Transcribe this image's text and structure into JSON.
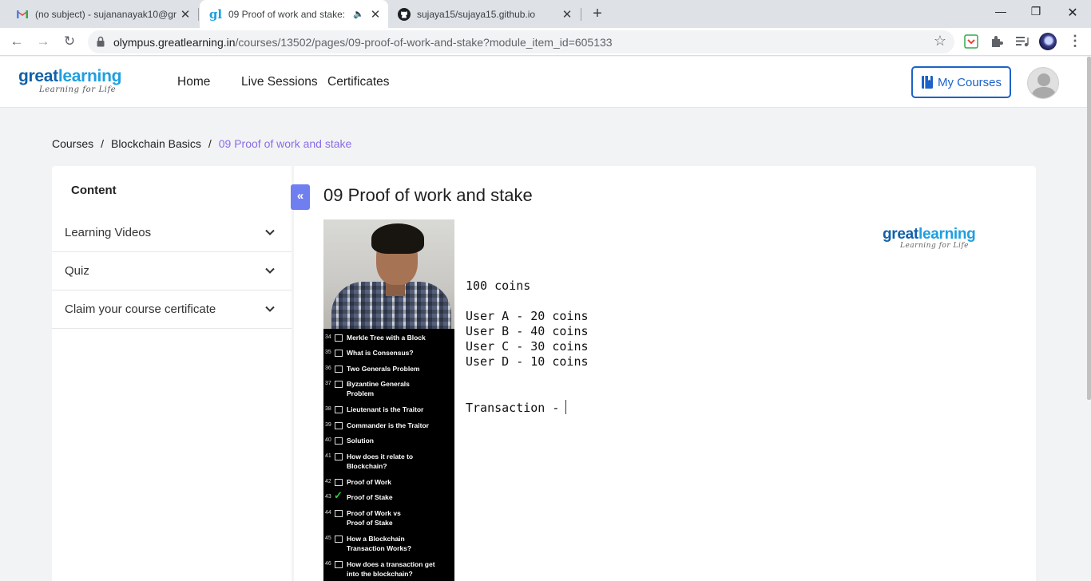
{
  "browser": {
    "tabs": [
      {
        "title": "(no subject) - sujananayak10@gr",
        "icon": "gmail-icon",
        "active": false
      },
      {
        "title": "09 Proof of work and stake: P",
        "icon": "greatlearning-icon",
        "active": true
      },
      {
        "title": "sujaya15/sujaya15.github.io",
        "icon": "github-icon",
        "active": false
      }
    ],
    "url_host": "olympus.greatlearning.in",
    "url_path": "/courses/13502/pages/09-proof-of-work-and-stake?module_item_id=605133"
  },
  "header": {
    "logo_part1": "great",
    "logo_part2": "learning",
    "logo_tagline": "Learning for Life",
    "nav": [
      "Home",
      "Live Sessions",
      "Certificates"
    ],
    "my_courses": "My Courses"
  },
  "breadcrumb": {
    "items": [
      "Courses",
      "Blockchain Basics"
    ],
    "current": "09 Proof of work and stake"
  },
  "sidebar": {
    "heading": "Content",
    "sections": [
      "Learning Videos",
      "Quiz",
      "Claim your course certificate"
    ]
  },
  "main": {
    "title": "09 Proof of work and stake"
  },
  "video": {
    "items": [
      {
        "num": "34",
        "label": "Merkle Tree with a Block",
        "checked": false
      },
      {
        "num": "35",
        "label": "What is Consensus?",
        "checked": false
      },
      {
        "num": "36",
        "label": "Two Generals Problem",
        "checked": false
      },
      {
        "num": "37",
        "label": "Byzantine Generals Problem",
        "checked": false
      },
      {
        "num": "38",
        "label": "Lieutenant is the Traitor",
        "checked": false
      },
      {
        "num": "39",
        "label": "Commander is the Traitor",
        "checked": false
      },
      {
        "num": "40",
        "label": "Solution",
        "checked": false
      },
      {
        "num": "41",
        "label": "How does it relate to Blockchain?",
        "checked": false
      },
      {
        "num": "42",
        "label": "Proof of Work",
        "checked": false
      },
      {
        "num": "43",
        "label": "Proof of Stake",
        "checked": true
      },
      {
        "num": "44",
        "label": "Proof of Work vs Proof of Stake",
        "checked": false
      },
      {
        "num": "45",
        "label": "How a Blockchain Transaction Works?",
        "checked": false
      },
      {
        "num": "46",
        "label": "How does a transaction get into the blockchain?",
        "checked": false
      }
    ],
    "slide_logo_part1": "great",
    "slide_logo_part2": "learning",
    "slide_logo_tagline": "Learning for Life",
    "slide_lines": {
      "total": "100 coins",
      "user_a": "User A - 20 coins",
      "user_b": "User B - 40 coins",
      "user_c": "User C - 30 coins",
      "user_d": "User D - 10 coins",
      "transaction": "Transaction - "
    }
  },
  "colors": {
    "accent": "#1c62c9",
    "breadcrumb_current": "#8b6ce8",
    "collapse_button": "#6f7ff0"
  }
}
